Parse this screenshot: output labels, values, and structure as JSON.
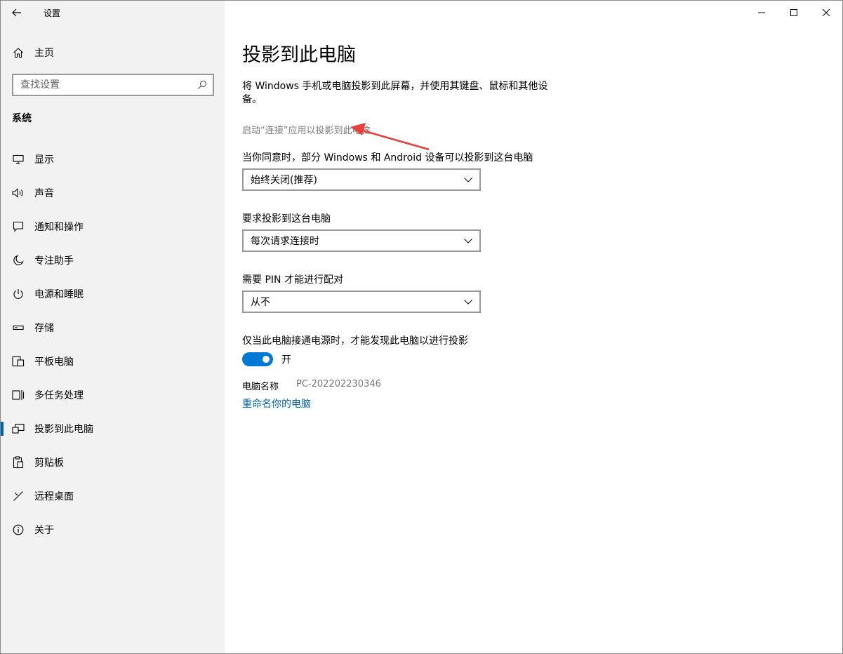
{
  "window": {
    "app_title": "设置"
  },
  "sidebar": {
    "home_label": "主页",
    "search_placeholder": "查找设置",
    "section_title": "系统",
    "items": [
      {
        "label": "显示",
        "icon": "monitor-icon"
      },
      {
        "label": "声音",
        "icon": "speaker-icon"
      },
      {
        "label": "通知和操作",
        "icon": "notification-icon"
      },
      {
        "label": "专注助手",
        "icon": "moon-icon"
      },
      {
        "label": "电源和睡眠",
        "icon": "power-icon"
      },
      {
        "label": "存储",
        "icon": "storage-icon"
      },
      {
        "label": "平板电脑",
        "icon": "tablet-icon"
      },
      {
        "label": "多任务处理",
        "icon": "multitask-icon"
      },
      {
        "label": "投影到此电脑",
        "icon": "project-icon",
        "active": true
      },
      {
        "label": "剪贴板",
        "icon": "clipboard-icon"
      },
      {
        "label": "远程桌面",
        "icon": "remote-desktop-icon"
      },
      {
        "label": "关于",
        "icon": "info-icon"
      }
    ]
  },
  "main": {
    "title": "投影到此电脑",
    "description": "将 Windows 手机或电脑投影到此屏幕，并使用其键盘、鼠标和其他设备。",
    "launch_link": "启动“连接”应用以投影到此电脑",
    "settings": [
      {
        "label": "当你同意时，部分 Windows 和 Android 设备可以投影到这台电脑",
        "value": "始终关闭(推荐)"
      },
      {
        "label": "要求投影到这台电脑",
        "value": "每次请求连接时"
      },
      {
        "label": "需要 PIN 才能进行配对",
        "value": "从不"
      }
    ],
    "power_toggle_label": "仅当此电脑接通电源时，才能发现此电脑以进行投影",
    "power_toggle_state": "开",
    "pc_name_label": "电脑名称",
    "pc_name_value": "PC-202202230346",
    "rename_link": "重命名你的电脑"
  },
  "colors": {
    "accent": "#0078d7",
    "link": "#0063b1",
    "sidebar_bg": "#f2f2f2",
    "annotation_arrow": "#e8403a"
  }
}
